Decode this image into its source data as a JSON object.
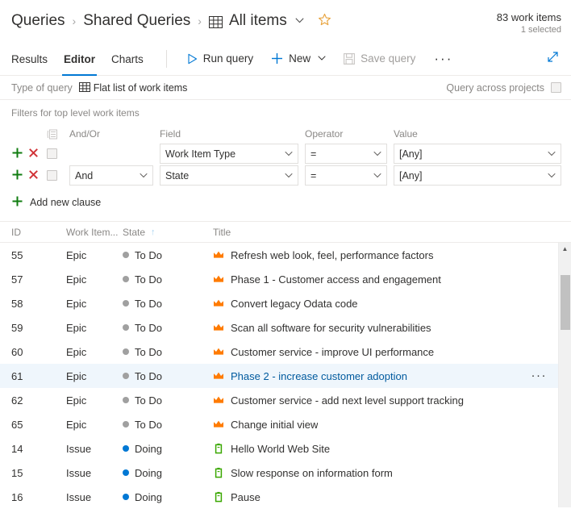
{
  "header": {
    "breadcrumb": [
      {
        "label": "Queries",
        "icon": null
      },
      {
        "label": "Shared Queries",
        "icon": null
      },
      {
        "label": "All items",
        "icon": "grid-icon"
      }
    ],
    "separator": "›",
    "dropdown_chevron": "⌄",
    "favorite_icon": "star-outline-icon",
    "work_item_count": "83 work items",
    "selected_count": "1 selected"
  },
  "toolbar": {
    "tabs": [
      {
        "label": "Results",
        "active": false
      },
      {
        "label": "Editor",
        "active": true
      },
      {
        "label": "Charts",
        "active": false
      }
    ],
    "run_query_label": "Run query",
    "run_query_icon": "play-icon",
    "new_label": "New",
    "new_icon": "plus-icon",
    "save_query_label": "Save query",
    "save_query_icon": "save-disk-icon",
    "save_query_disabled": true,
    "more_label": "···",
    "fullscreen_icon": "expand-arrow-icon"
  },
  "query_type": {
    "label": "Type of query",
    "icon": "grid-icon",
    "value": "Flat list of work items",
    "across_projects_label": "Query across projects",
    "across_projects_checked": false
  },
  "filters": {
    "title": "Filters for top level work items",
    "columns": {
      "select_icon": "column-options-icon",
      "andor": "And/Or",
      "field": "Field",
      "operator": "Operator",
      "value": "Value"
    },
    "add_icon": "plus-icon",
    "delete_icon": "close-x-icon",
    "chevron": "⌄",
    "rows": [
      {
        "andor": "",
        "field": "Work Item Type",
        "operator": "=",
        "value": "[Any]",
        "checked": false,
        "show_andor": false
      },
      {
        "andor": "And",
        "field": "State",
        "operator": "=",
        "value": "[Any]",
        "checked": false,
        "show_andor": true
      }
    ],
    "add_clause_label": "Add new clause"
  },
  "results": {
    "columns": [
      {
        "key": "id",
        "label": "ID"
      },
      {
        "key": "type",
        "label": "Work Item..."
      },
      {
        "key": "state",
        "label": "State",
        "sorted": "asc",
        "sort_glyph": "↑"
      },
      {
        "key": "title",
        "label": "Title"
      }
    ],
    "row_menu_glyph": "···",
    "scroll_up_glyph": "▲",
    "rows": [
      {
        "id": "55",
        "type": "Epic",
        "state": "To Do",
        "state_color": "#a0a0a0",
        "title": "Refresh web look, feel, performance factors",
        "icon": "crown-icon",
        "icon_color": "#ff7b00",
        "selected": false
      },
      {
        "id": "57",
        "type": "Epic",
        "state": "To Do",
        "state_color": "#a0a0a0",
        "title": "Phase 1 - Customer access and engagement",
        "icon": "crown-icon",
        "icon_color": "#ff7b00",
        "selected": false
      },
      {
        "id": "58",
        "type": "Epic",
        "state": "To Do",
        "state_color": "#a0a0a0",
        "title": "Convert legacy Odata code",
        "icon": "crown-icon",
        "icon_color": "#ff7b00",
        "selected": false
      },
      {
        "id": "59",
        "type": "Epic",
        "state": "To Do",
        "state_color": "#a0a0a0",
        "title": "Scan all software for security vulnerabilities",
        "icon": "crown-icon",
        "icon_color": "#ff7b00",
        "selected": false
      },
      {
        "id": "60",
        "type": "Epic",
        "state": "To Do",
        "state_color": "#a0a0a0",
        "title": "Customer service - improve UI performance",
        "icon": "crown-icon",
        "icon_color": "#ff7b00",
        "selected": false
      },
      {
        "id": "61",
        "type": "Epic",
        "state": "To Do",
        "state_color": "#a0a0a0",
        "title": "Phase 2 - increase customer adoption",
        "icon": "crown-icon",
        "icon_color": "#ff7b00",
        "selected": true
      },
      {
        "id": "62",
        "type": "Epic",
        "state": "To Do",
        "state_color": "#a0a0a0",
        "title": "Customer service - add next level support tracking",
        "icon": "crown-icon",
        "icon_color": "#ff7b00",
        "selected": false
      },
      {
        "id": "65",
        "type": "Epic",
        "state": "To Do",
        "state_color": "#a0a0a0",
        "title": "Change initial view",
        "icon": "crown-icon",
        "icon_color": "#ff7b00",
        "selected": false
      },
      {
        "id": "14",
        "type": "Issue",
        "state": "Doing",
        "state_color": "#0078d4",
        "title": "Hello World Web Site",
        "icon": "issue-book-icon",
        "icon_color": "#3aa700",
        "selected": false
      },
      {
        "id": "15",
        "type": "Issue",
        "state": "Doing",
        "state_color": "#0078d4",
        "title": "Slow response on information form",
        "icon": "issue-book-icon",
        "icon_color": "#3aa700",
        "selected": false
      },
      {
        "id": "16",
        "type": "Issue",
        "state": "Doing",
        "state_color": "#0078d4",
        "title": "Pause",
        "icon": "issue-book-icon",
        "icon_color": "#3aa700",
        "selected": false
      }
    ]
  },
  "colors": {
    "accent": "#0078d4",
    "link": "#005a9e",
    "selected_row_bg": "#eff6fc",
    "add_green": "#107c10",
    "delete_red": "#d13438",
    "star_gold": "#e8a33d"
  }
}
